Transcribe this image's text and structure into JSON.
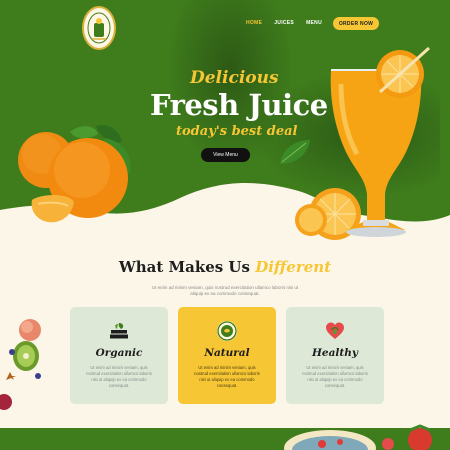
{
  "nav": {
    "items": [
      {
        "label": "HOME",
        "active": true
      },
      {
        "label": "JUICES",
        "active": false
      },
      {
        "label": "MENU",
        "active": false
      }
    ],
    "order_label": "ORDER NOW"
  },
  "hero": {
    "pre_title": "Delicious",
    "title": "Fresh Juice",
    "subtitle": "today's best deal",
    "button_label": "View Menu"
  },
  "features": {
    "title_main": "What Makes Us",
    "title_highlight": "Different",
    "description": "Ut enim ad minim veniam, quis nostrud exercitation ullamco laboris nisi ut aliquip ex ea commodo consequat.",
    "cards": [
      {
        "title": "Organic",
        "icon": "organic-badge-icon",
        "text": "Ut enim ad minim veniam, quis nostrud exercitation ullamco laboris nisi ut aliquip ex ea commodo consequat."
      },
      {
        "title": "Natural",
        "icon": "natural-badge-icon",
        "text": "Ut enim ad minim veniam, quis nostrud exercitation ullamco laboris nisi ut aliquip ex ea commodo consequat."
      },
      {
        "title": "Healthy",
        "icon": "heart-icon",
        "text": "Ut enim ad minim veniam, quis nostrud exercitation ullamco laboris nisi ut aliquip ex ea commodo consequat."
      }
    ]
  },
  "colors": {
    "green": "#3f7d1c",
    "yellow": "#f6c634",
    "cream": "#fbf6e8",
    "mint": "#dde9d6"
  }
}
